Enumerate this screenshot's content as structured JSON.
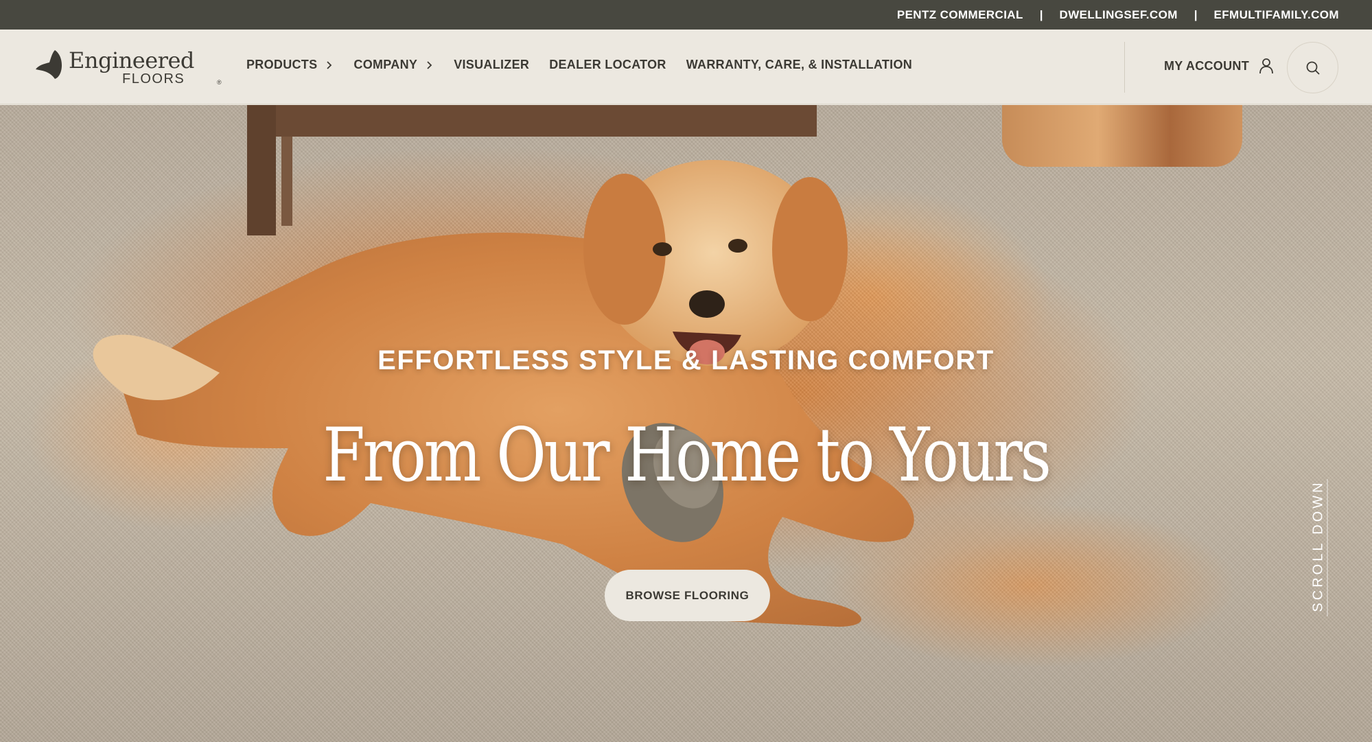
{
  "top_bar": {
    "links": [
      "PENTZ COMMERCIAL",
      "DWELLINGSEF.COM",
      "EFMULTIFAMILY.COM"
    ],
    "separator": "|"
  },
  "header": {
    "logo": {
      "word1": "Engineered",
      "word2": "FLOORS",
      "reg": "®"
    },
    "nav": {
      "products": "PRODUCTS",
      "company": "COMPANY",
      "visualizer": "VISUALIZER",
      "dealer_locator": "DEALER LOCATOR",
      "warranty": "WARRANTY, CARE, & INSTALLATION"
    },
    "account_label": "MY ACCOUNT"
  },
  "hero": {
    "tagline": "EFFORTLESS STYLE & LASTING COMFORT",
    "title": "From Our Home to Yours",
    "button": "BROWSE FLOORING",
    "scroll": "SCROLL DOWN"
  },
  "colors": {
    "top_bar_bg": "#484840",
    "header_bg": "#ece8e0",
    "text_dark": "#3c3a34",
    "button_bg": "#ece8e0"
  }
}
